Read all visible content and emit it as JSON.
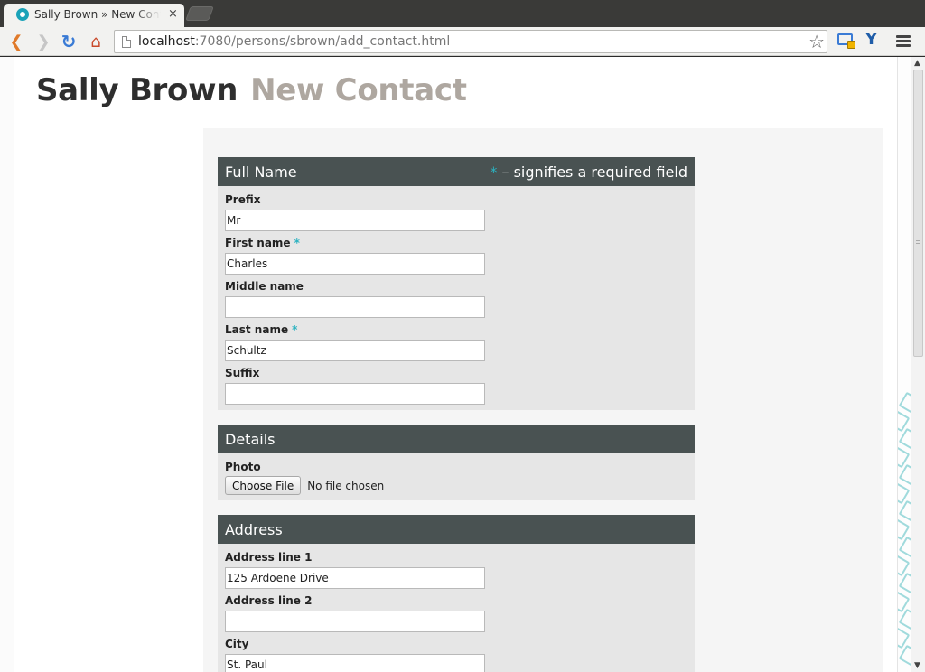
{
  "browser": {
    "tab_title": "Sally Brown » New Contact",
    "tab_close": "×",
    "url_host": "localhost",
    "url_rest": ":7080/persons/sbrown/add_contact.html"
  },
  "page": {
    "person_name": "Sally Brown",
    "subtitle": "New Contact"
  },
  "sections": {
    "full_name": {
      "title": "Full Name",
      "required_star": "*",
      "required_note": " – signifies a required field",
      "prefix_label": "Prefix",
      "prefix_value": "Mr",
      "first_name_label": "First name",
      "first_name_value": "Charles",
      "middle_name_label": "Middle name",
      "middle_name_value": "",
      "last_name_label": "Last name",
      "last_name_value": "Schultz",
      "suffix_label": "Suffix",
      "suffix_value": "",
      "star": "*"
    },
    "details": {
      "title": "Details",
      "photo_label": "Photo",
      "choose_file": "Choose File",
      "no_file": "No file chosen"
    },
    "address": {
      "title": "Address",
      "line1_label": "Address line 1",
      "line1_value": "125 Ardoene Drive",
      "line2_label": "Address line 2",
      "line2_value": "",
      "city_label": "City",
      "city_value": "St. Paul"
    }
  },
  "colors": {
    "section_header": "#495252",
    "required_star": "#2bb2c0",
    "subtitle": "#aea7a0"
  }
}
